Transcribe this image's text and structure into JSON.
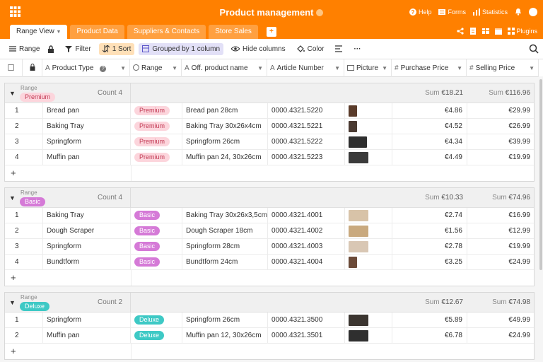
{
  "app": {
    "title": "Product management",
    "top_items": [
      {
        "label": "Help",
        "icon": "help-icon"
      },
      {
        "label": "Forms",
        "icon": "forms-icon"
      },
      {
        "label": "Statistics",
        "icon": "statistics-icon"
      }
    ],
    "plugins_label": "Plugins"
  },
  "tabs": [
    {
      "label": "Range View",
      "active": true
    },
    {
      "label": "Product Data"
    },
    {
      "label": "Suppliers & Contacts"
    },
    {
      "label": "Store Sales"
    }
  ],
  "toolbar": {
    "range": "Range",
    "filter": "Filter",
    "sort": "1 Sort",
    "group": "Grouped by 1 column",
    "hide": "Hide columns",
    "color": "Color",
    "more": "···"
  },
  "columns": {
    "product_type": "Product Type",
    "range": "Range",
    "off_name": "Off. product name",
    "article": "Article Number",
    "picture": "Picture",
    "purchase": "Purchase Price",
    "selling": "Selling Price"
  },
  "groups": [
    {
      "label": "Range",
      "value": "Premium",
      "count": "Count 4",
      "sum_purchase": "€18.21",
      "sum_selling": "€116.96",
      "rows": [
        {
          "n": "1",
          "type": "Bread pan",
          "range": "Premium",
          "name": "Bread pan 28cm",
          "article": "0000.4321.5220",
          "purchase": "€4.86",
          "selling": "€29.99"
        },
        {
          "n": "2",
          "type": "Baking Tray",
          "range": "Premium",
          "name": "Baking Tray 30x26x4cm",
          "article": "0000.4321.5221",
          "purchase": "€4.52",
          "selling": "€26.99"
        },
        {
          "n": "3",
          "type": "Springform",
          "range": "Premium",
          "name": "Springform 26cm",
          "article": "0000.4321.5222",
          "purchase": "€4.34",
          "selling": "€39.99"
        },
        {
          "n": "4",
          "type": "Muffin pan",
          "range": "Premium",
          "name": "Muffin pan 24, 30x26cm",
          "article": "0000.4321.5223",
          "purchase": "€4.49",
          "selling": "€19.99"
        }
      ]
    },
    {
      "label": "Range",
      "value": "Basic",
      "count": "Count 4",
      "sum_purchase": "€10.33",
      "sum_selling": "€74.96",
      "rows": [
        {
          "n": "1",
          "type": "Baking Tray",
          "range": "Basic",
          "name": "Baking Tray 30x26x3,5cm",
          "article": "0000.4321.4001",
          "purchase": "€2.74",
          "selling": "€16.99"
        },
        {
          "n": "2",
          "type": "Dough Scraper",
          "range": "Basic",
          "name": "Dough Scraper 18cm",
          "article": "0000.4321.4002",
          "purchase": "€1.56",
          "selling": "€12.99"
        },
        {
          "n": "3",
          "type": "Springform",
          "range": "Basic",
          "name": "Springform 28cm",
          "article": "0000.4321.4003",
          "purchase": "€2.78",
          "selling": "€19.99"
        },
        {
          "n": "4",
          "type": "Bundtform",
          "range": "Basic",
          "name": "Bundtform 24cm",
          "article": "0000.4321.4004",
          "purchase": "€3.25",
          "selling": "€24.99"
        }
      ]
    },
    {
      "label": "Range",
      "value": "Deluxe",
      "count": "Count 2",
      "sum_purchase": "€12.67",
      "sum_selling": "€74.98",
      "rows": [
        {
          "n": "1",
          "type": "Springform",
          "range": "Deluxe",
          "name": "Springform 26cm",
          "article": "0000.4321.3500",
          "purchase": "€5.89",
          "selling": "€49.99"
        },
        {
          "n": "2",
          "type": "Muffin pan",
          "range": "Deluxe",
          "name": "Muffin pan 12, 30x26cm",
          "article": "0000.4321.3501",
          "purchase": "€6.78",
          "selling": "€24.99"
        }
      ]
    }
  ],
  "sum_label": "Sum",
  "colors": {
    "brand": "#ff8000",
    "premium": "#fcd5dc",
    "basic": "#d57ad7",
    "deluxe": "#3ec9c5"
  }
}
